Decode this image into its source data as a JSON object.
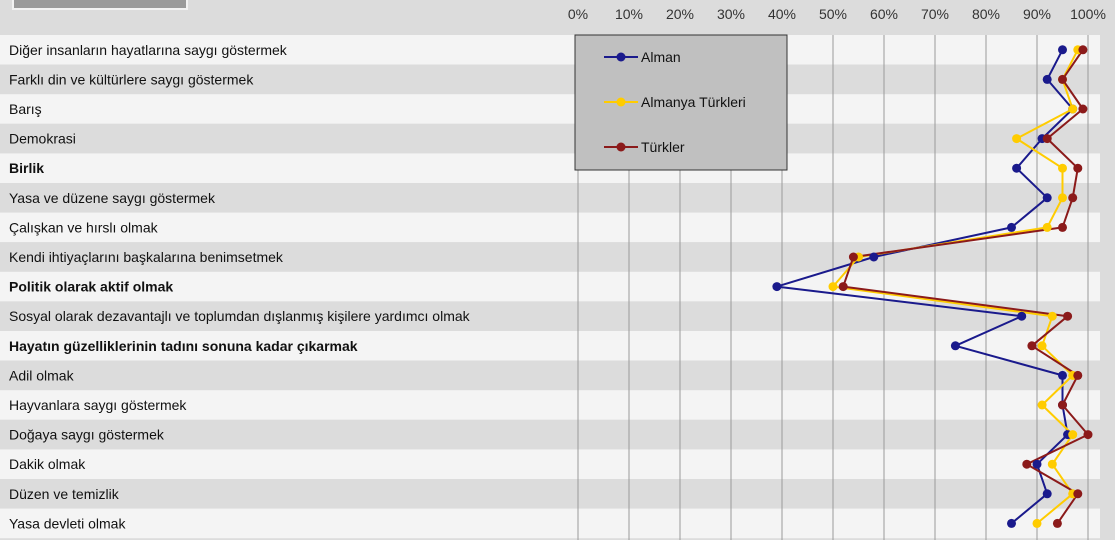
{
  "chart_data": {
    "type": "line",
    "orientation": "horizontal",
    "x_ticks": [
      "0%",
      "10%",
      "20%",
      "30%",
      "40%",
      "50%",
      "60%",
      "70%",
      "80%",
      "90%",
      "100%"
    ],
    "xlim": [
      0,
      100
    ],
    "grid": true,
    "legend_placement": "top-left of plot",
    "categories": [
      {
        "label": "Diğer insanların hayatlarına saygı göstermek",
        "bold": false
      },
      {
        "label": "Farklı din ve kültürlere saygı göstermek",
        "bold": false
      },
      {
        "label": "Barış",
        "bold": false
      },
      {
        "label": "Demokrasi",
        "bold": false
      },
      {
        "label": "Birlik",
        "bold": true
      },
      {
        "label": "Yasa ve düzene saygı göstermek",
        "bold": false
      },
      {
        "label": "Çalışkan ve hırslı olmak",
        "bold": false
      },
      {
        "label": "Kendi ihtiyaçlarını başkalarına benimsetmek",
        "bold": false
      },
      {
        "label": "Politik olarak aktif olmak",
        "bold": true
      },
      {
        "label": "Sosyal olarak dezavantajlı ve toplumdan dışlanmış kişilere yardımcı olmak",
        "bold": false
      },
      {
        "label": "Hayatın güzelliklerinin tadını sonuna kadar çıkarmak",
        "bold": true
      },
      {
        "label": "Adil olmak",
        "bold": false
      },
      {
        "label": "Hayvanlara saygı göstermek",
        "bold": false
      },
      {
        "label": "Doğaya saygı göstermek",
        "bold": false
      },
      {
        "label": "Dakik olmak",
        "bold": false
      },
      {
        "label": "Düzen ve temizlik",
        "bold": false
      },
      {
        "label": "Yasa devleti olmak",
        "bold": false
      }
    ],
    "series": [
      {
        "name": "Alman",
        "color": "#1a1a8c",
        "values": [
          95,
          92,
          97,
          91,
          86,
          92,
          85,
          58,
          39,
          87,
          74,
          95,
          95,
          96,
          90,
          92,
          85
        ]
      },
      {
        "name": "Almanya Türkleri",
        "color": "#ffcc00",
        "values": [
          98,
          95,
          97,
          86,
          95,
          95,
          92,
          55,
          50,
          93,
          91,
          97,
          91,
          97,
          93,
          97,
          90
        ]
      },
      {
        "name": "Türkler",
        "color": "#8b1a1a",
        "values": [
          99,
          95,
          99,
          92,
          98,
          97,
          95,
          54,
          52,
          96,
          89,
          98,
          95,
          100,
          88,
          98,
          94
        ]
      }
    ]
  }
}
